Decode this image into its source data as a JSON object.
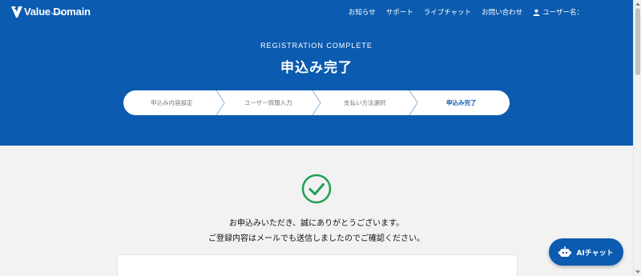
{
  "header": {
    "logo_text": "Value Domain",
    "logo_sub": "by GMO",
    "nav": [
      "お知らせ",
      "サポート",
      "ライブチャット",
      "お問い合わせ"
    ],
    "user_label": "ユーザー名："
  },
  "hero": {
    "subtitle_en": "REGISTRATION COMPLETE",
    "title": "申込み完了",
    "steps": [
      "申込み内容設定",
      "ユーザー情報入力",
      "支払い方法選択",
      "申込み完了"
    ],
    "active_step": 4
  },
  "main": {
    "message_line1": "お申込みいただき、誠にありがとうございます。",
    "message_line2": "ご登録内容はメールでも送信しましたのでご確認ください。"
  },
  "ai_chat": {
    "label": "AIチャット"
  },
  "colors": {
    "brand": "#0b5bb0",
    "success": "#1fa055"
  }
}
